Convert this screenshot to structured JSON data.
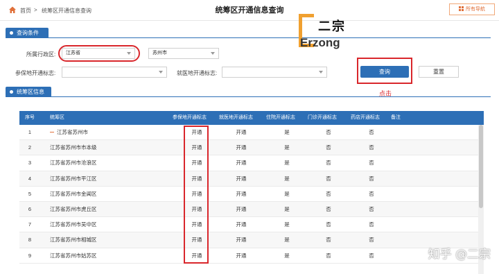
{
  "breadcrumb": {
    "home": "首页",
    "separator": ">",
    "current": "统筹区开通信息查询"
  },
  "page_title": "统筹区开通信息查询",
  "nav_button": "所有导航",
  "query_section": {
    "title": "查询条件"
  },
  "form": {
    "region_label": "所属行政区:",
    "province_value": "江苏省",
    "city_value": "苏州市",
    "insured_flag_label": "参保地开通标志:",
    "insured_flag_value": "",
    "medical_flag_label": "就医地开通标志:",
    "medical_flag_value": "",
    "query_button": "查询",
    "reset_button": "重置",
    "click_note": "点击"
  },
  "watermark": {
    "cn": "二宗",
    "en": "Erzong",
    "zhihu": "知乎 @二宗"
  },
  "result_section": {
    "title": "统筹区信息"
  },
  "colors": {
    "primary": "#2d6fb6",
    "highlight": "#d9262b",
    "accent": "#e0703a",
    "logo": "#f0a030"
  },
  "table": {
    "headers": [
      "序号",
      "统筹区",
      "参保地开通标志",
      "就医地开通标志",
      "住院开通标志",
      "门诊开通标志",
      "药店开通标志",
      "备注"
    ],
    "rows": [
      {
        "no": "1",
        "name": "江苏省苏州市",
        "insured": "开通",
        "medical": "开通",
        "inpatient": "是",
        "outpatient": "否",
        "pharmacy": "否",
        "note": ""
      },
      {
        "no": "2",
        "name": "江苏省苏州市市本级",
        "insured": "开通",
        "medical": "开通",
        "inpatient": "是",
        "outpatient": "否",
        "pharmacy": "否",
        "note": ""
      },
      {
        "no": "3",
        "name": "江苏省苏州市沧浪区",
        "insured": "开通",
        "medical": "开通",
        "inpatient": "是",
        "outpatient": "否",
        "pharmacy": "否",
        "note": ""
      },
      {
        "no": "4",
        "name": "江苏省苏州市平江区",
        "insured": "开通",
        "medical": "开通",
        "inpatient": "是",
        "outpatient": "否",
        "pharmacy": "否",
        "note": ""
      },
      {
        "no": "5",
        "name": "江苏省苏州市金阊区",
        "insured": "开通",
        "medical": "开通",
        "inpatient": "是",
        "outpatient": "否",
        "pharmacy": "否",
        "note": ""
      },
      {
        "no": "6",
        "name": "江苏省苏州市虎丘区",
        "insured": "开通",
        "medical": "开通",
        "inpatient": "是",
        "outpatient": "否",
        "pharmacy": "否",
        "note": ""
      },
      {
        "no": "7",
        "name": "江苏省苏州市吴中区",
        "insured": "开通",
        "medical": "开通",
        "inpatient": "是",
        "outpatient": "否",
        "pharmacy": "否",
        "note": ""
      },
      {
        "no": "8",
        "name": "江苏省苏州市相城区",
        "insured": "开通",
        "medical": "开通",
        "inpatient": "是",
        "outpatient": "否",
        "pharmacy": "否",
        "note": ""
      },
      {
        "no": "9",
        "name": "江苏省苏州市姑苏区",
        "insured": "开通",
        "medical": "开通",
        "inpatient": "是",
        "outpatient": "否",
        "pharmacy": "否",
        "note": ""
      }
    ]
  }
}
